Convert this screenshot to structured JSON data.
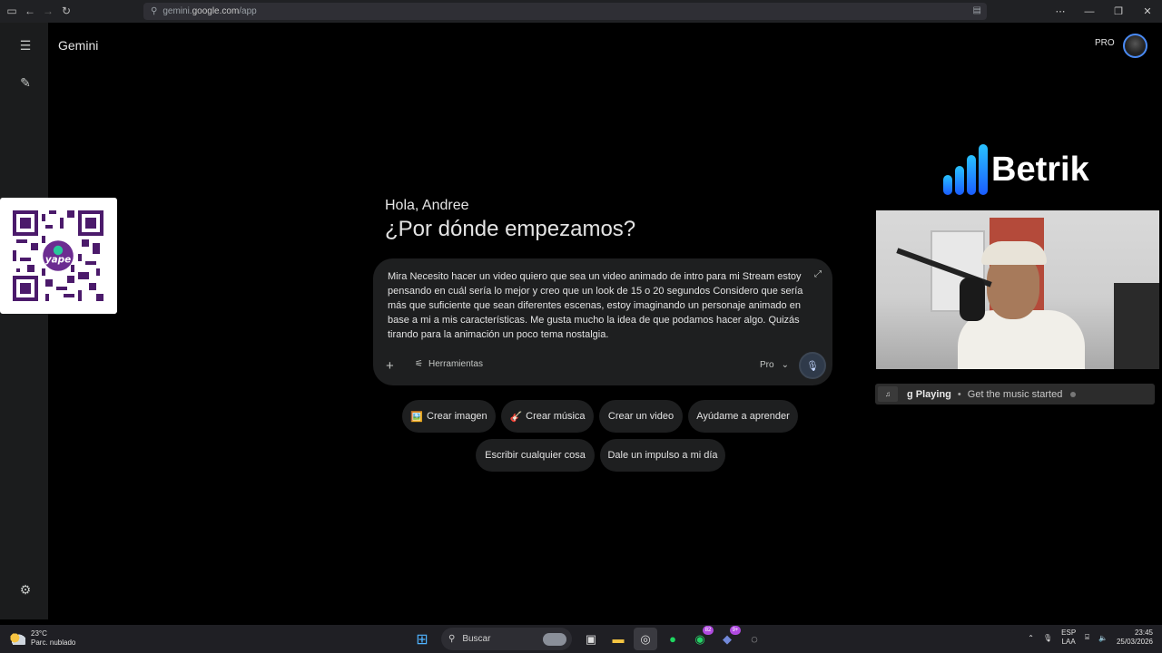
{
  "browser": {
    "url_prefix": "gemini.",
    "url_host": "google.com",
    "url_path": "/app"
  },
  "app": {
    "title": "Gemini",
    "plan_badge": "PRO"
  },
  "greeting": {
    "line1": "Hola, Andree",
    "line2": "¿Por dónde empezamos?"
  },
  "prompt": {
    "text": "Mira Necesito hacer un video quiero que sea un video animado de intro para mi Stream estoy pensando en cuál sería lo mejor y creo que un look de 15 o 20 segundos Considero que sería más que suficiente que sean diferentes escenas, estoy imaginando un personaje animado en base a mi a mis características. Me gusta mucho la idea de que podamos hacer algo. Quizás tirando para la animación un poco tema nostalgia.",
    "tools_label": "Herramientas",
    "model_label": "Pro"
  },
  "chips": [
    {
      "label": "Crear imagen",
      "emoji": "🖼️"
    },
    {
      "label": "Crear música",
      "emoji": "🎸"
    },
    {
      "label": "Crear un video",
      "emoji": ""
    },
    {
      "label": "Ayúdame a aprender",
      "emoji": ""
    },
    {
      "label": "Escribir cualquier cosa",
      "emoji": ""
    },
    {
      "label": "Dale un impulso a mi día",
      "emoji": ""
    }
  ],
  "overlay": {
    "brand_name": "Betrik",
    "now_playing_title": "g Playing",
    "now_playing_text": "Get the music started",
    "qr_label": "yape"
  },
  "taskbar": {
    "temperature": "23°C",
    "weather": "Parc. nublado",
    "search_label": "Buscar",
    "whatsapp_badge": "82",
    "discord_badge": "9+",
    "lang_line1": "ESP",
    "lang_line2": "LAA",
    "time": "23:45",
    "date": "25/03/2026"
  },
  "colors": {
    "page_bg": "#000000",
    "sidebar_bg": "#1b1c1d",
    "input_bg": "#1e1f20",
    "accent": "#4a8af4",
    "brand_gradient_top": "#29c2ff",
    "brand_gradient_bottom": "#1a5cff"
  }
}
